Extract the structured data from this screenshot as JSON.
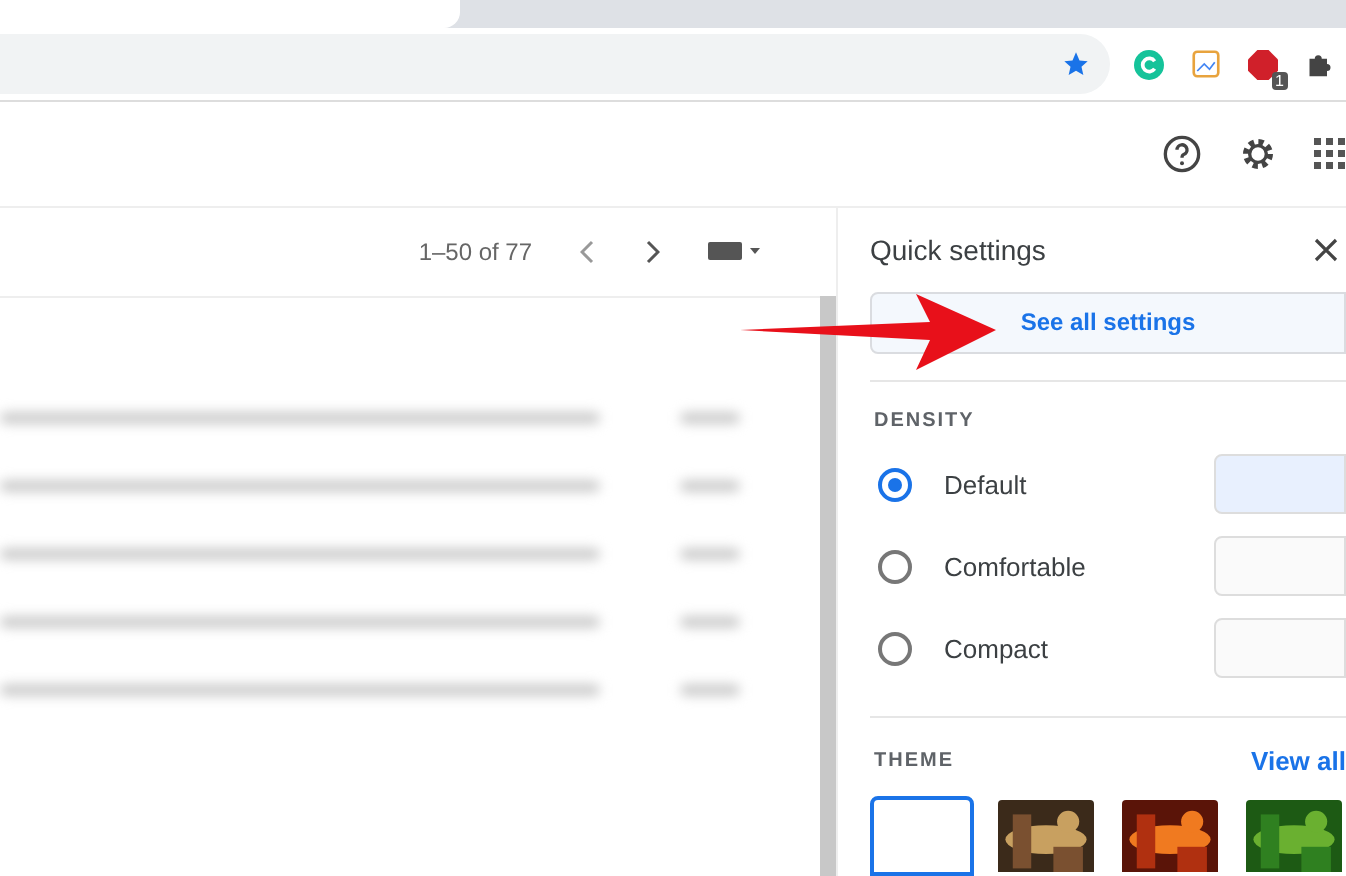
{
  "browser": {
    "extension_badge": "1"
  },
  "toolbar": {
    "pagination": "1–50 of 77"
  },
  "quick_settings": {
    "title": "Quick settings",
    "see_all": "See all settings",
    "density_label": "DENSITY",
    "density_options": [
      {
        "label": "Default",
        "selected": true
      },
      {
        "label": "Comfortable",
        "selected": false
      },
      {
        "label": "Compact",
        "selected": false
      }
    ],
    "theme_label": "THEME",
    "view_all": "View all",
    "themes": [
      {
        "kind": "default",
        "selected": true
      },
      {
        "kind": "picture",
        "selected": false
      },
      {
        "kind": "picture",
        "selected": false
      },
      {
        "kind": "picture",
        "selected": false
      }
    ]
  }
}
